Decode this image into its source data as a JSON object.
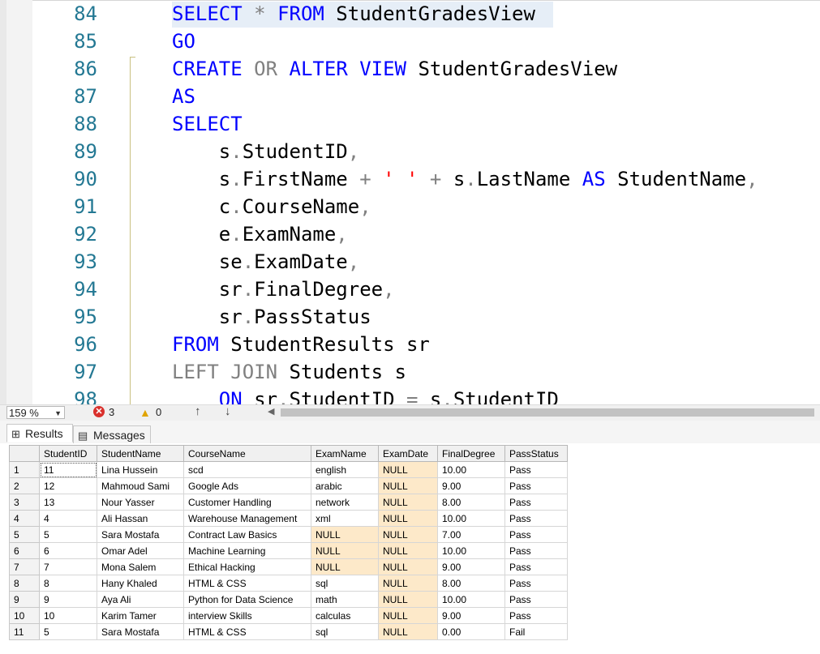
{
  "editor": {
    "lines": [
      {
        "num": "84",
        "tokens": [
          [
            "kw",
            "SELECT"
          ],
          [
            "pl",
            " "
          ],
          [
            "op",
            "*"
          ],
          [
            "pl",
            " "
          ],
          [
            "kw",
            "FROM"
          ],
          [
            "pl",
            " StudentGradesView"
          ]
        ]
      },
      {
        "num": "85",
        "tokens": [
          [
            "kw",
            "GO"
          ]
        ]
      },
      {
        "num": "86",
        "tokens": [
          [
            "kw",
            "CREATE"
          ],
          [
            "pl",
            " "
          ],
          [
            "gk",
            "OR"
          ],
          [
            "pl",
            " "
          ],
          [
            "kw",
            "ALTER VIEW"
          ],
          [
            "pl",
            " StudentGradesView"
          ]
        ]
      },
      {
        "num": "87",
        "tokens": [
          [
            "kw",
            "AS"
          ]
        ]
      },
      {
        "num": "88",
        "tokens": [
          [
            "kw",
            "SELECT"
          ]
        ]
      },
      {
        "num": "89",
        "tokens": [
          [
            "pl",
            "    s"
          ],
          [
            "op",
            "."
          ],
          [
            "pl",
            "StudentID"
          ],
          [
            "op",
            ","
          ]
        ]
      },
      {
        "num": "90",
        "tokens": [
          [
            "pl",
            "    s"
          ],
          [
            "op",
            "."
          ],
          [
            "pl",
            "FirstName "
          ],
          [
            "op",
            "+"
          ],
          [
            "pl",
            " "
          ],
          [
            "st",
            "' '"
          ],
          [
            "pl",
            " "
          ],
          [
            "op",
            "+"
          ],
          [
            "pl",
            " s"
          ],
          [
            "op",
            "."
          ],
          [
            "pl",
            "LastName "
          ],
          [
            "kw",
            "AS"
          ],
          [
            "pl",
            " StudentName"
          ],
          [
            "op",
            ","
          ]
        ]
      },
      {
        "num": "91",
        "tokens": [
          [
            "pl",
            "    c"
          ],
          [
            "op",
            "."
          ],
          [
            "pl",
            "CourseName"
          ],
          [
            "op",
            ","
          ]
        ]
      },
      {
        "num": "92",
        "tokens": [
          [
            "pl",
            "    e"
          ],
          [
            "op",
            "."
          ],
          [
            "pl",
            "ExamName"
          ],
          [
            "op",
            ","
          ]
        ]
      },
      {
        "num": "93",
        "tokens": [
          [
            "pl",
            "    se"
          ],
          [
            "op",
            "."
          ],
          [
            "pl",
            "ExamDate"
          ],
          [
            "op",
            ","
          ]
        ]
      },
      {
        "num": "94",
        "tokens": [
          [
            "pl",
            "    sr"
          ],
          [
            "op",
            "."
          ],
          [
            "pl",
            "FinalDegree"
          ],
          [
            "op",
            ","
          ]
        ]
      },
      {
        "num": "95",
        "tokens": [
          [
            "pl",
            "    sr"
          ],
          [
            "op",
            "."
          ],
          [
            "pl",
            "PassStatus"
          ]
        ]
      },
      {
        "num": "96",
        "tokens": [
          [
            "kw",
            "FROM"
          ],
          [
            "pl",
            " StudentResults sr"
          ]
        ]
      },
      {
        "num": "97",
        "tokens": [
          [
            "gk",
            "LEFT JOIN"
          ],
          [
            "pl",
            " Students s"
          ]
        ]
      },
      {
        "num": "98",
        "tokens": [
          [
            "pl",
            "    "
          ],
          [
            "kw",
            "ON"
          ],
          [
            "pl",
            " sr"
          ],
          [
            "op",
            "."
          ],
          [
            "pl",
            "StudentID "
          ],
          [
            "op",
            "="
          ],
          [
            "pl",
            " s"
          ],
          [
            "op",
            "."
          ],
          [
            "pl",
            "StudentID"
          ]
        ]
      }
    ]
  },
  "statusbar": {
    "zoom": "159 %",
    "error_count": "3",
    "warning_count": "0",
    "error_glyph": "✕",
    "warning_glyph": "▲",
    "up_glyph": "↑",
    "down_glyph": "↓",
    "scroll_left_glyph": "◀"
  },
  "tabs": {
    "results": "Results",
    "messages": "Messages",
    "results_icon": "⊞",
    "messages_icon": "▤"
  },
  "grid": {
    "columns": [
      "StudentID",
      "StudentName",
      "CourseName",
      "ExamName",
      "ExamDate",
      "FinalDegree",
      "PassStatus"
    ],
    "rows": [
      [
        "1",
        "11",
        "Lina Hussein",
        "scd",
        "english",
        "NULL",
        "10.00",
        "Pass"
      ],
      [
        "2",
        "12",
        "Mahmoud Sami",
        "Google Ads",
        "arabic",
        "NULL",
        "9.00",
        "Pass"
      ],
      [
        "3",
        "13",
        "Nour Yasser",
        "Customer Handling",
        "network",
        "NULL",
        "8.00",
        "Pass"
      ],
      [
        "4",
        "4",
        "Ali Hassan",
        "Warehouse Management",
        "xml",
        "NULL",
        "10.00",
        "Pass"
      ],
      [
        "5",
        "5",
        "Sara Mostafa",
        "Contract Law Basics",
        "NULL",
        "NULL",
        "7.00",
        "Pass"
      ],
      [
        "6",
        "6",
        "Omar Adel",
        "Machine Learning",
        "NULL",
        "NULL",
        "10.00",
        "Pass"
      ],
      [
        "7",
        "7",
        "Mona Salem",
        "Ethical Hacking",
        "NULL",
        "NULL",
        "9.00",
        "Pass"
      ],
      [
        "8",
        "8",
        "Hany Khaled",
        "HTML & CSS",
        "sql",
        "NULL",
        "8.00",
        "Pass"
      ],
      [
        "9",
        "9",
        "Aya Ali",
        "Python for Data Science",
        "math",
        "NULL",
        "10.00",
        "Pass"
      ],
      [
        "10",
        "10",
        "Karim Tamer",
        "interview Skills",
        "calculas",
        "NULL",
        "9.00",
        "Pass"
      ],
      [
        "11",
        "5",
        "Sara Mostafa",
        "HTML & CSS",
        "sql",
        "NULL",
        "0.00",
        "Fail"
      ]
    ]
  }
}
